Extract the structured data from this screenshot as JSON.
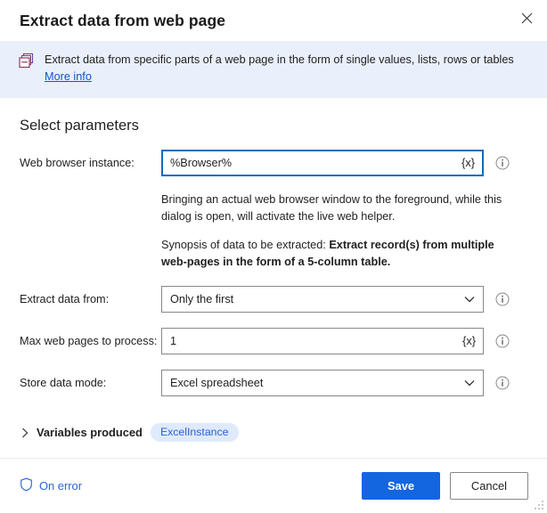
{
  "dialog": {
    "title": "Extract data from web page",
    "close_icon": "close-icon"
  },
  "banner": {
    "icon": "extract-records-icon",
    "text": "Extract data from specific parts of a web page in the form of single values, lists, rows or tables",
    "link": "More info"
  },
  "section": {
    "title": "Select parameters"
  },
  "fields": {
    "browser_instance": {
      "label": "Web browser instance:",
      "value": "%Browser%",
      "variable_button": "{x}",
      "info_icon": "info-icon"
    },
    "extract_from": {
      "label": "Extract data from:",
      "value": "Only the first",
      "chevron_icon": "chevron-down-icon",
      "info_icon": "info-icon"
    },
    "max_pages": {
      "label": "Max web pages to process:",
      "value": "1",
      "variable_button": "{x}",
      "info_icon": "info-icon"
    },
    "store_mode": {
      "label": "Store data mode:",
      "value": "Excel spreadsheet",
      "chevron_icon": "chevron-down-icon",
      "info_icon": "info-icon"
    }
  },
  "description": {
    "paragraph1": "Bringing an actual web browser window to the foreground, while this dialog is open, will activate the live web helper.",
    "paragraph2_prefix": "Synopsis of data to be extracted: ",
    "paragraph2_bold": "Extract record(s) from multiple web-pages in the form of a 5-column table."
  },
  "variables_produced": {
    "chevron_icon": "chevron-right-icon",
    "label": "Variables produced",
    "badge": "ExcelInstance"
  },
  "footer": {
    "on_error_icon": "shield-icon",
    "on_error_label": "On error",
    "save_label": "Save",
    "cancel_label": "Cancel"
  },
  "colors": {
    "accent": "#1466e0",
    "banner_bg": "#e9f0fb",
    "link": "#1155cc",
    "badge_bg": "#dfeafc",
    "badge_text": "#2562d8",
    "field_border": "#8a8886",
    "focus_border": "#0f6cbd",
    "banner_icon": "#7a3b52"
  }
}
